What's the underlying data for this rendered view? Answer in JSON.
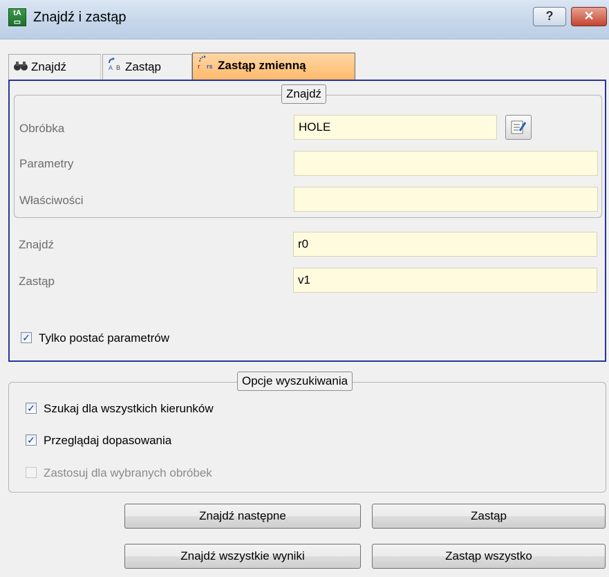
{
  "window": {
    "title": "Znajdź i zastąp",
    "help_label": "?",
    "close_label": "✕"
  },
  "tabs": [
    {
      "label": "Znajdź",
      "icon": "binoculars-icon"
    },
    {
      "label": "Zastąp",
      "icon": "replace-icon"
    },
    {
      "label": "Zastąp zmienną",
      "icon": "replace-variable-icon",
      "active": true
    }
  ],
  "find_group": {
    "legend": "Znajdź",
    "rows": [
      {
        "label": "Obróbka",
        "value": "HOLE"
      },
      {
        "label": "Parametry",
        "value": ""
      },
      {
        "label": "Właściwości",
        "value": ""
      }
    ]
  },
  "replace": {
    "find_label": "Znajdź",
    "find_value": "r0",
    "replace_label": "Zastąp",
    "replace_value": "v1"
  },
  "only_params": {
    "label": "Tylko postać parametrów",
    "checked": true
  },
  "search_options": {
    "legend": "Opcje wyszukiwania",
    "items": [
      {
        "label": "Szukaj dla wszystkich kierunków",
        "checked": true,
        "enabled": true
      },
      {
        "label": "Przeglądaj dopasowania",
        "checked": true,
        "enabled": true
      },
      {
        "label": "Zastosuj dla wybranych obróbek",
        "checked": false,
        "enabled": false
      }
    ]
  },
  "buttons": {
    "find_next": "Znajdź następne",
    "replace": "Zastąp",
    "find_all": "Znajdź wszystkie wyniki",
    "replace_all": "Zastąp wszystko"
  }
}
